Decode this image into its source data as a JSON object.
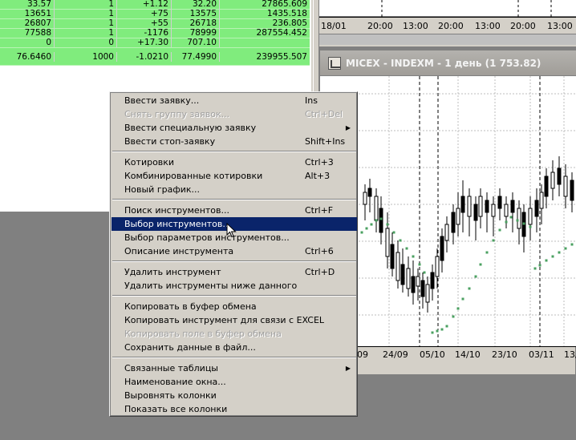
{
  "quote_table": {
    "rows": [
      {
        "c0": "33.57",
        "c1": "1",
        "c2": "+1.12",
        "c3": "32.20",
        "c4": "27865.609"
      },
      {
        "c0": "13651",
        "c1": "1",
        "c2": "+75",
        "c3": "13575",
        "c4": "1435.518"
      },
      {
        "c0": "26807",
        "c1": "1",
        "c2": "+55",
        "c3": "26718",
        "c4": "236.805"
      },
      {
        "c0": "77588",
        "c1": "1",
        "c2": "-1176",
        "c3": "78999",
        "c4": "287554.452"
      },
      {
        "c0": "0",
        "c1": "0",
        "c2": "+17.30",
        "c3": "707.10",
        "c4": ""
      },
      {
        "c0": "76.6460",
        "c1": "1000",
        "c2": "-1.0210",
        "c3": "77.4990",
        "c4": "239955.507"
      }
    ]
  },
  "top_chart": {
    "x_labels": [
      "18/01",
      "20:00",
      "13:00",
      "20:00",
      "13:00",
      "20:00",
      "13:00"
    ]
  },
  "chart_window": {
    "title": "MICEX - INDEXM - 1 день (1 753.82)",
    "x_labels": [
      "09",
      "24/09",
      "05/10",
      "14/10",
      "23/10",
      "03/11",
      "13/"
    ]
  },
  "chart_data": {
    "type": "candlestick",
    "x": [
      "24/09",
      "05/10",
      "14/10",
      "23/10",
      "03/11"
    ],
    "title": "MICEX - INDEXM - 1 день (1 753.82)",
    "series": [
      {
        "values": []
      }
    ]
  },
  "context_menu": {
    "items": [
      {
        "label": "Ввести заявку...",
        "shortcut": "Ins"
      },
      {
        "label": "Снять группу заявок...",
        "shortcut": "Ctrl+Del"
      },
      {
        "label": "Ввести специальную заявку",
        "shortcut": ""
      },
      {
        "label": "Ввести стоп-заявку",
        "shortcut": "Shift+Ins"
      },
      {
        "label": "Котировки",
        "shortcut": "Ctrl+3"
      },
      {
        "label": "Комбинированные котировки",
        "shortcut": "Alt+3"
      },
      {
        "label": "Новый график...",
        "shortcut": ""
      },
      {
        "label": "Поиск инструментов...",
        "shortcut": "Ctrl+F"
      },
      {
        "label": "Выбор инструментов...",
        "shortcut": ""
      },
      {
        "label": "Выбор параметров инструментов...",
        "shortcut": ""
      },
      {
        "label": "Описание инструмента",
        "shortcut": "Ctrl+6"
      },
      {
        "label": "Удалить инструмент",
        "shortcut": "Ctrl+D"
      },
      {
        "label": "Удалить инструменты ниже данного",
        "shortcut": ""
      },
      {
        "label": "Копировать в буфер обмена",
        "shortcut": ""
      },
      {
        "label": "Копировать инструмент для связи с EXCEL",
        "shortcut": ""
      },
      {
        "label": "Копировать поле в буфер обмена",
        "shortcut": ""
      },
      {
        "label": "Сохранить данные в файл...",
        "shortcut": ""
      },
      {
        "label": "Связанные таблицы",
        "shortcut": ""
      },
      {
        "label": "Наименование окна...",
        "shortcut": ""
      },
      {
        "label": "Выровнять колонки",
        "shortcut": ""
      },
      {
        "label": "Показать все колонки",
        "shortcut": ""
      }
    ]
  }
}
